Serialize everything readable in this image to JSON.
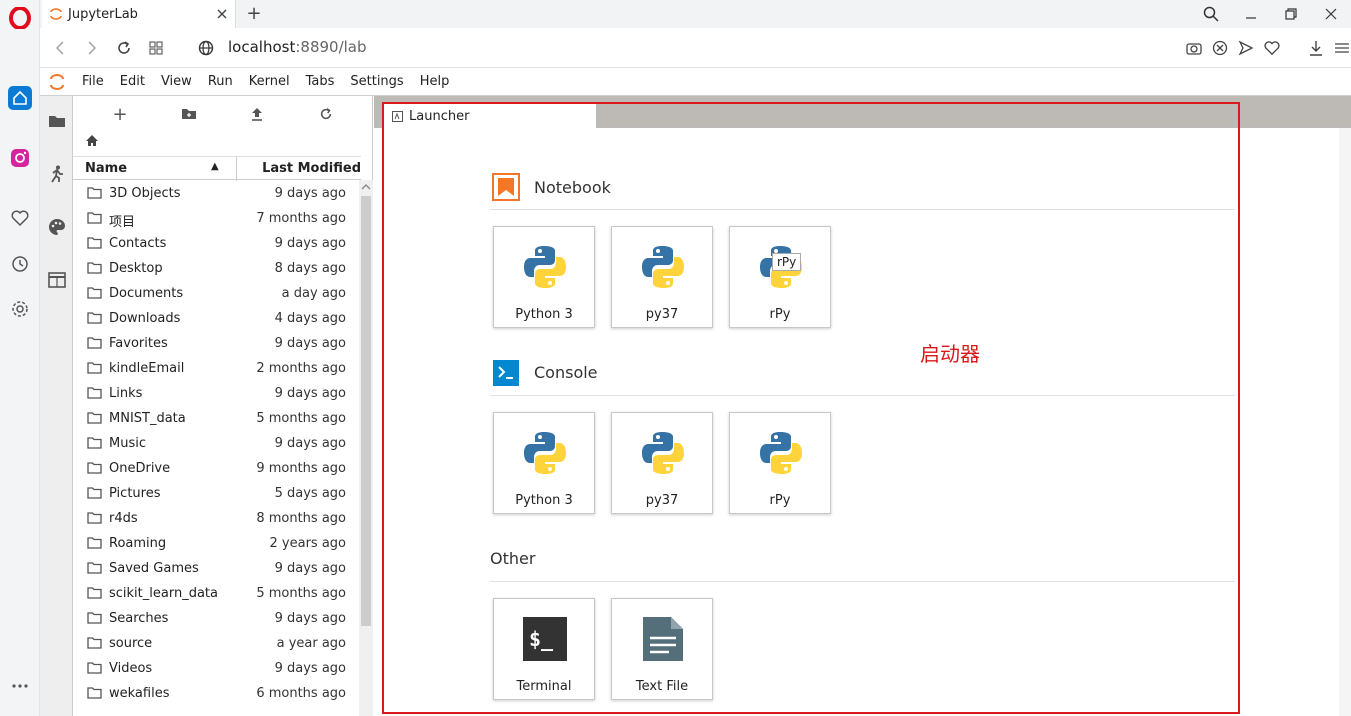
{
  "browser": {
    "tab_title": "JupyterLab",
    "url_host": "localhost",
    "url_rest": ":8890/lab"
  },
  "menu": [
    "File",
    "Edit",
    "View",
    "Run",
    "Kernel",
    "Tabs",
    "Settings",
    "Help"
  ],
  "filebrowser": {
    "col_name": "Name",
    "col_modified": "Last Modified",
    "rows": [
      {
        "name": "3D Objects",
        "modified": "9 days ago"
      },
      {
        "name": "项目",
        "modified": "7 months ago"
      },
      {
        "name": "Contacts",
        "modified": "9 days ago"
      },
      {
        "name": "Desktop",
        "modified": "8 days ago"
      },
      {
        "name": "Documents",
        "modified": "a day ago"
      },
      {
        "name": "Downloads",
        "modified": "4 days ago"
      },
      {
        "name": "Favorites",
        "modified": "9 days ago"
      },
      {
        "name": "kindleEmail",
        "modified": "2 months ago"
      },
      {
        "name": "Links",
        "modified": "9 days ago"
      },
      {
        "name": "MNIST_data",
        "modified": "5 months ago"
      },
      {
        "name": "Music",
        "modified": "9 days ago"
      },
      {
        "name": "OneDrive",
        "modified": "9 months ago"
      },
      {
        "name": "Pictures",
        "modified": "5 days ago"
      },
      {
        "name": "r4ds",
        "modified": "8 months ago"
      },
      {
        "name": "Roaming",
        "modified": "2 years ago"
      },
      {
        "name": "Saved Games",
        "modified": "9 days ago"
      },
      {
        "name": "scikit_learn_data",
        "modified": "5 months ago"
      },
      {
        "name": "Searches",
        "modified": "9 days ago"
      },
      {
        "name": "source",
        "modified": "a year ago"
      },
      {
        "name": "Videos",
        "modified": "9 days ago"
      },
      {
        "name": "wekafiles",
        "modified": "6 months ago"
      }
    ]
  },
  "launcher": {
    "tab_label": "Launcher",
    "notebook_title": "Notebook",
    "console_title": "Console",
    "other_title": "Other",
    "notebook_kernels": [
      "Python 3",
      "py37",
      "rPy"
    ],
    "console_kernels": [
      "Python 3",
      "py37",
      "rPy"
    ],
    "other_items": [
      "Terminal",
      "Text File"
    ],
    "tooltip": "rPy"
  },
  "annotation": {
    "text": "启动器",
    "color": "#d9181a"
  },
  "colors": {
    "jupyter_orange": "#f37726",
    "python_blue": "#3572a5",
    "python_yellow": "#ffd43b",
    "console_blue": "#0288d1"
  }
}
